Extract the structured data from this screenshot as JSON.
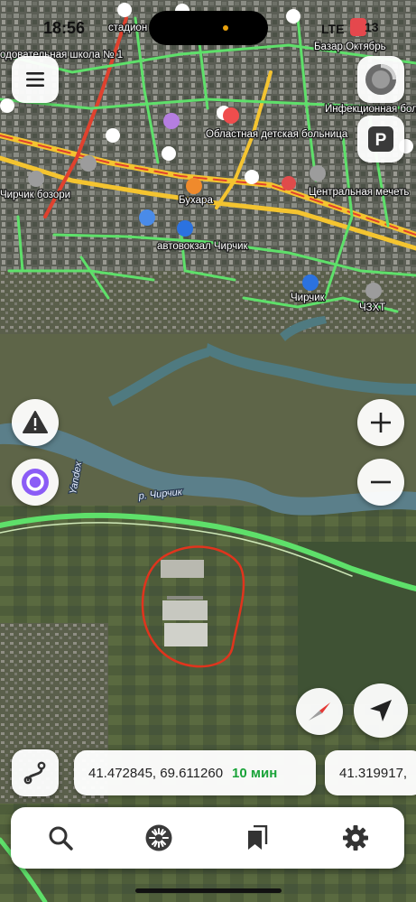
{
  "status_bar": {
    "time": "18:56",
    "network": "LTE",
    "battery": "13"
  },
  "map": {
    "labels": {
      "stadion": "стадион",
      "uchilishche": "одовательная школа № 1",
      "bazaar": "Базар Октябрь",
      "hospital_children": "Областная детская больница",
      "infectious": "Инфекционная больница",
      "chirchik_bazori": "Чирчик бозори",
      "bukhara": "Бухара",
      "central_mosque": "Центральная мечеть",
      "bus_station": "автовокзал Чирчик",
      "chirchik_station": "Чирчик",
      "chzkht": "ЧЗХТ",
      "river": "р. Чирчик",
      "yandex": "Yandex"
    },
    "highlight": {
      "shape": "hand-drawn loop",
      "color": "#e0341d"
    },
    "colors": {
      "traffic_green": "#5ee06a",
      "traffic_yellow": "#f4c430",
      "traffic_red": "#e0412e",
      "river": "#5b7f8a"
    }
  },
  "controls": {
    "menu": "menu-icon",
    "avatar": "profile-avatar",
    "parking": "P",
    "alert": "warning-icon",
    "alice": "alice-icon",
    "zoom_in": "+",
    "zoom_out": "−",
    "compass": "compass-icon",
    "locate": "location-arrow-icon",
    "route": "route-icon"
  },
  "routes": [
    {
      "coords": "41.472845, 69.611260",
      "eta": "10 мин"
    },
    {
      "coords": "41.319917,"
    }
  ],
  "bottom_nav": {
    "items": [
      "search-icon",
      "discovery-icon",
      "bookmarks-icon",
      "settings-icon"
    ]
  }
}
